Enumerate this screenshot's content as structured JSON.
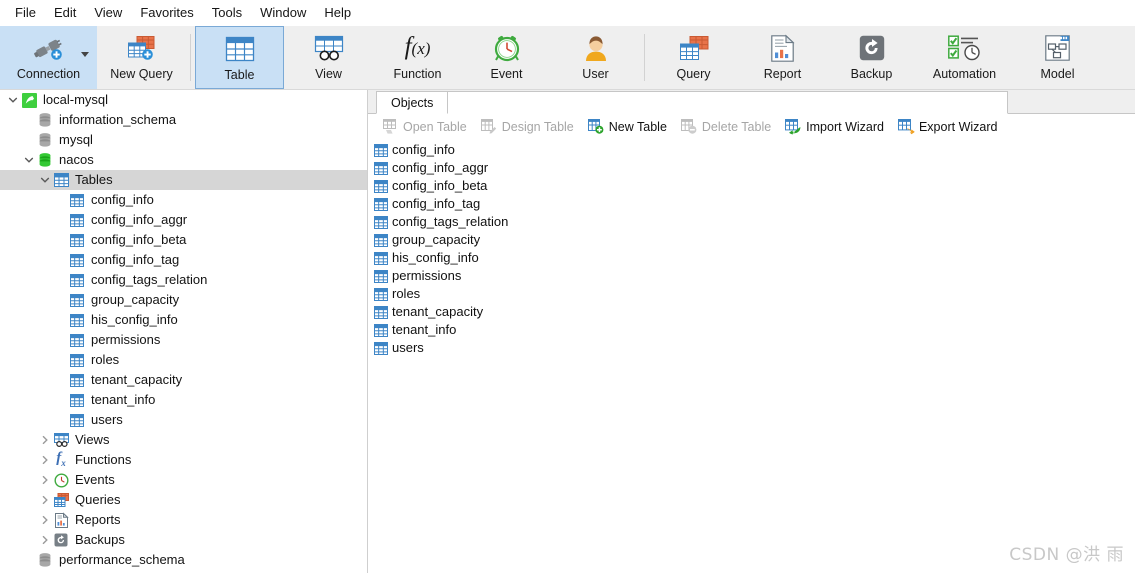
{
  "menubar": {
    "items": [
      {
        "label": "File",
        "name": "menu-file"
      },
      {
        "label": "Edit",
        "name": "menu-edit"
      },
      {
        "label": "View",
        "name": "menu-view"
      },
      {
        "label": "Favorites",
        "name": "menu-favorites"
      },
      {
        "label": "Tools",
        "name": "menu-tools"
      },
      {
        "label": "Window",
        "name": "menu-window"
      },
      {
        "label": "Help",
        "name": "menu-help"
      }
    ]
  },
  "toolbar": {
    "buttons": [
      {
        "label": "Connection",
        "icon": "connection-icon",
        "state": "highlighted",
        "has_caret": true
      },
      {
        "label": "New Query",
        "icon": "new-query-icon",
        "state": "normal",
        "has_caret": false
      },
      {
        "label": "Table",
        "icon": "table-icon",
        "state": "selected",
        "has_caret": false
      },
      {
        "label": "View",
        "icon": "view-icon",
        "state": "normal",
        "has_caret": false
      },
      {
        "label": "Function",
        "icon": "function-icon",
        "state": "normal",
        "has_caret": false
      },
      {
        "label": "Event",
        "icon": "event-icon",
        "state": "normal",
        "has_caret": false
      },
      {
        "label": "User",
        "icon": "user-icon",
        "state": "normal",
        "has_caret": false
      },
      {
        "label": "Query",
        "icon": "query-icon",
        "state": "normal",
        "has_caret": false
      },
      {
        "label": "Report",
        "icon": "report-icon",
        "state": "normal",
        "has_caret": false
      },
      {
        "label": "Backup",
        "icon": "backup-icon",
        "state": "normal",
        "has_caret": false
      },
      {
        "label": "Automation",
        "icon": "automation-icon",
        "state": "normal",
        "has_caret": false
      },
      {
        "label": "Model",
        "icon": "model-icon",
        "state": "normal",
        "has_caret": false
      }
    ]
  },
  "sidebar": {
    "tree": [
      {
        "label": "local-mysql",
        "icon": "connection-node-icon",
        "indent": 0,
        "expander": "expanded",
        "selected": false
      },
      {
        "label": "information_schema",
        "icon": "database-gray-icon",
        "indent": 1,
        "expander": "none",
        "selected": false
      },
      {
        "label": "mysql",
        "icon": "database-gray-icon",
        "indent": 1,
        "expander": "none",
        "selected": false
      },
      {
        "label": "nacos",
        "icon": "database-green-icon",
        "indent": 1,
        "expander": "expanded",
        "selected": false
      },
      {
        "label": "Tables",
        "icon": "tables-folder-icon",
        "indent": 2,
        "expander": "expanded",
        "selected": true
      },
      {
        "label": "config_info",
        "icon": "table-node-icon",
        "indent": 3,
        "expander": "none",
        "selected": false
      },
      {
        "label": "config_info_aggr",
        "icon": "table-node-icon",
        "indent": 3,
        "expander": "none",
        "selected": false
      },
      {
        "label": "config_info_beta",
        "icon": "table-node-icon",
        "indent": 3,
        "expander": "none",
        "selected": false
      },
      {
        "label": "config_info_tag",
        "icon": "table-node-icon",
        "indent": 3,
        "expander": "none",
        "selected": false
      },
      {
        "label": "config_tags_relation",
        "icon": "table-node-icon",
        "indent": 3,
        "expander": "none",
        "selected": false
      },
      {
        "label": "group_capacity",
        "icon": "table-node-icon",
        "indent": 3,
        "expander": "none",
        "selected": false
      },
      {
        "label": "his_config_info",
        "icon": "table-node-icon",
        "indent": 3,
        "expander": "none",
        "selected": false
      },
      {
        "label": "permissions",
        "icon": "table-node-icon",
        "indent": 3,
        "expander": "none",
        "selected": false
      },
      {
        "label": "roles",
        "icon": "table-node-icon",
        "indent": 3,
        "expander": "none",
        "selected": false
      },
      {
        "label": "tenant_capacity",
        "icon": "table-node-icon",
        "indent": 3,
        "expander": "none",
        "selected": false
      },
      {
        "label": "tenant_info",
        "icon": "table-node-icon",
        "indent": 3,
        "expander": "none",
        "selected": false
      },
      {
        "label": "users",
        "icon": "table-node-icon",
        "indent": 3,
        "expander": "none",
        "selected": false
      },
      {
        "label": "Views",
        "icon": "views-folder-icon",
        "indent": 2,
        "expander": "collapsed",
        "selected": false
      },
      {
        "label": "Functions",
        "icon": "functions-folder-icon",
        "indent": 2,
        "expander": "collapsed",
        "selected": false
      },
      {
        "label": "Events",
        "icon": "events-folder-icon",
        "indent": 2,
        "expander": "collapsed",
        "selected": false
      },
      {
        "label": "Queries",
        "icon": "queries-folder-icon",
        "indent": 2,
        "expander": "collapsed",
        "selected": false
      },
      {
        "label": "Reports",
        "icon": "reports-folder-icon",
        "indent": 2,
        "expander": "collapsed",
        "selected": false
      },
      {
        "label": "Backups",
        "icon": "backups-folder-icon",
        "indent": 2,
        "expander": "collapsed",
        "selected": false
      },
      {
        "label": "performance_schema",
        "icon": "database-gray-icon",
        "indent": 1,
        "expander": "none",
        "selected": false
      }
    ]
  },
  "main": {
    "tabs": [
      {
        "label": "Objects",
        "active": true
      }
    ],
    "object_toolbar": [
      {
        "label": "Open Table",
        "icon": "open-table-icon",
        "enabled": false
      },
      {
        "label": "Design Table",
        "icon": "design-table-icon",
        "enabled": false
      },
      {
        "label": "New Table",
        "icon": "new-table-icon",
        "enabled": true
      },
      {
        "label": "Delete Table",
        "icon": "delete-table-icon",
        "enabled": false
      },
      {
        "label": "Import Wizard",
        "icon": "import-wizard-icon",
        "enabled": true
      },
      {
        "label": "Export Wizard",
        "icon": "export-wizard-icon",
        "enabled": true
      }
    ],
    "objects": [
      {
        "name": "config_info",
        "icon": "table-node-icon"
      },
      {
        "name": "config_info_aggr",
        "icon": "table-node-icon"
      },
      {
        "name": "config_info_beta",
        "icon": "table-node-icon"
      },
      {
        "name": "config_info_tag",
        "icon": "table-node-icon"
      },
      {
        "name": "config_tags_relation",
        "icon": "table-node-icon"
      },
      {
        "name": "group_capacity",
        "icon": "table-node-icon"
      },
      {
        "name": "his_config_info",
        "icon": "table-node-icon"
      },
      {
        "name": "permissions",
        "icon": "table-node-icon"
      },
      {
        "name": "roles",
        "icon": "table-node-icon"
      },
      {
        "name": "tenant_capacity",
        "icon": "table-node-icon"
      },
      {
        "name": "tenant_info",
        "icon": "table-node-icon"
      },
      {
        "name": "users",
        "icon": "table-node-icon"
      }
    ]
  },
  "watermark": {
    "text": "CSDN @洪 雨"
  },
  "colors": {
    "ribbon_bg": "#efefef",
    "selected_button": "#c9e0f5",
    "selected_button_border": "#7aa9d6",
    "tree_selection": "#d6d6d6",
    "table_icon_blue": "#3d85c6",
    "database_green": "#2fbf34",
    "database_gray": "#9a9a9a",
    "disabled_text": "#a6a6a6"
  }
}
